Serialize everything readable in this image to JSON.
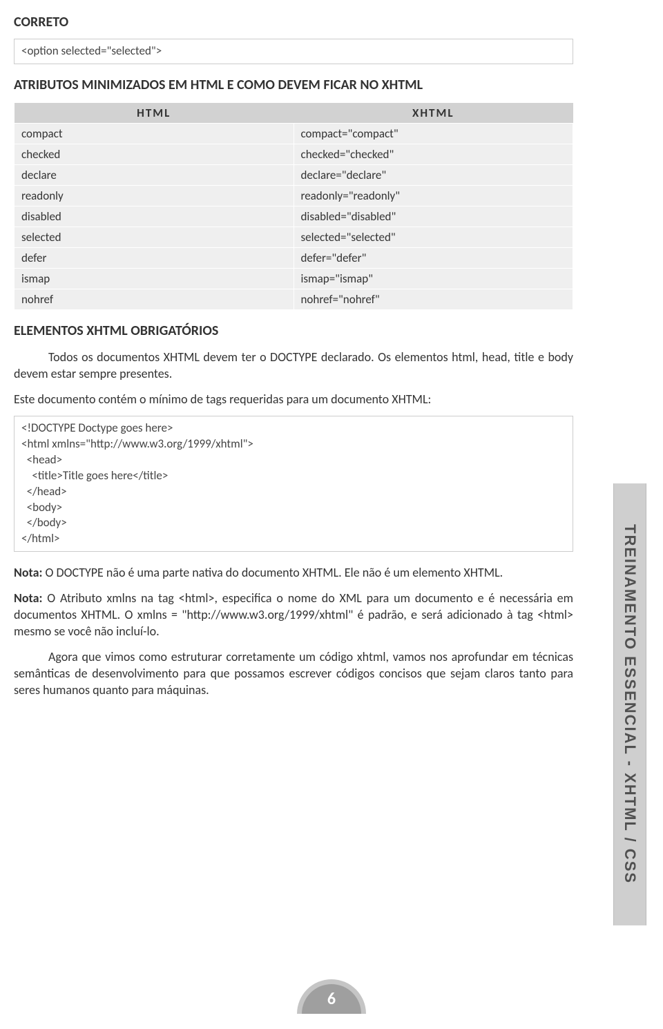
{
  "label_correto": "CORRETO",
  "code_box_1": "<option selected=\"selected\">",
  "section_title_1": "ATRIBUTOS MINIMIZADOS EM HTML E COMO DEVEM FICAR NO XHTML",
  "attr_table": {
    "head_left": "HTML",
    "head_right": "XHTML",
    "rows": [
      {
        "l": "compact",
        "r": "compact=\"compact\""
      },
      {
        "l": "checked",
        "r": "checked=\"checked\""
      },
      {
        "l": "declare",
        "r": "declare=\"declare\""
      },
      {
        "l": "readonly",
        "r": "readonly=\"readonly\""
      },
      {
        "l": "disabled",
        "r": "disabled=\"disabled\""
      },
      {
        "l": "selected",
        "r": "selected=\"selected\""
      },
      {
        "l": "defer",
        "r": "defer=\"defer\""
      },
      {
        "l": "ismap",
        "r": "ismap=\"ismap\""
      },
      {
        "l": "nohref",
        "r": "nohref=\"nohref\""
      }
    ]
  },
  "section_title_2": "ELEMENTOS XHTML OBRIGATÓRIOS",
  "para_1": "Todos os documentos XHTML devem ter o DOCTYPE declarado. Os elementos html, head, title e body devem estar sempre presentes.",
  "para_2": "Este documento contém o mínimo de tags requeridas para um documento XHTML:",
  "code_box_2": "<!DOCTYPE Doctype goes here>\n<html xmlns=\"http://www.w3.org/1999/xhtml\">\n  <head>\n    <title>Title goes here</title>\n  </head>\n  <body>\n  </body>\n</html>",
  "nota_1_label": "Nota:",
  "nota_1_text": " O DOCTYPE não é uma parte nativa do documento XHTML. Ele não é um elemento XHTML.",
  "nota_2_label": "Nota:",
  "nota_2_text": " O Atributo xmlns na tag <html>, especifica o nome do XML para um documento e é necessária em documentos XHTML. O xmlns = \"http://www.w3.org/1999/xhtml\" é padrão, e será adicionado à tag <html> mesmo se você não incluí-lo.",
  "para_3": "Agora que vimos como estruturar corretamente um código xhtml, vamos nos aprofundar em técnicas semânticas de desenvolvimento para que possamos escrever códigos concisos que sejam claros tanto para seres humanos quanto para máquinas.",
  "sidebar_label": "TREINAMENTO ESSENCIAL - XHTML / CSS",
  "page_number": "6"
}
